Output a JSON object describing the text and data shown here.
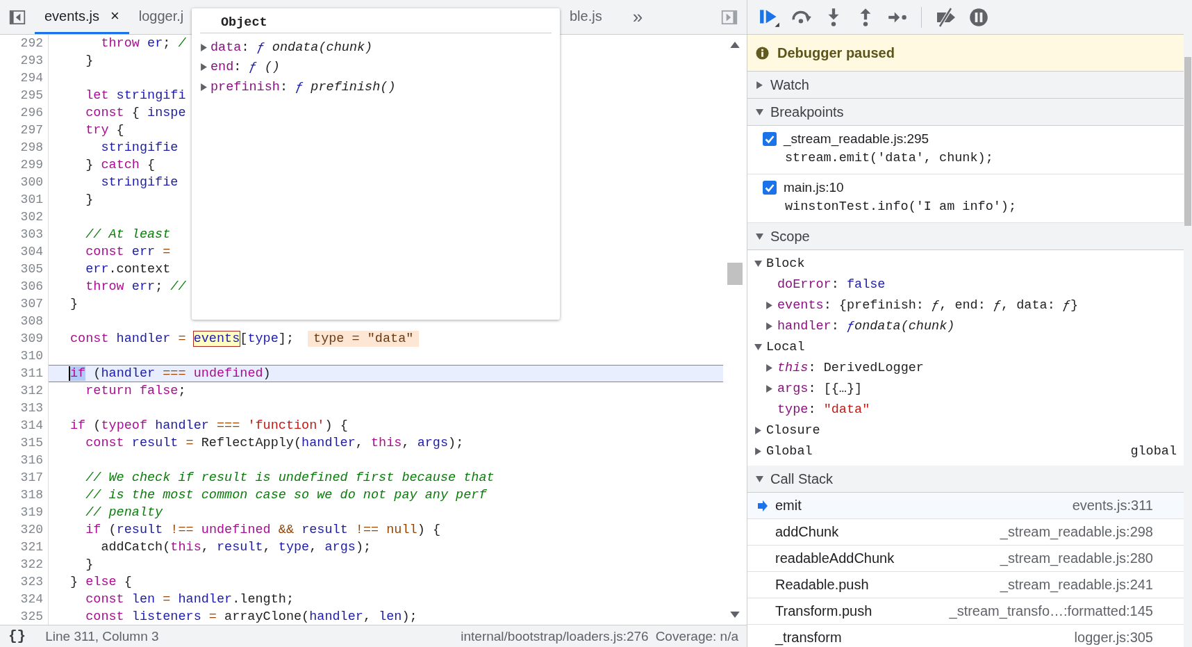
{
  "editor_tabs": {
    "items": [
      {
        "label": "events.js",
        "selected": true,
        "close": "×"
      },
      {
        "label": "logger.j",
        "selected": false
      },
      {
        "label": "ble.js",
        "selected": false
      }
    ],
    "overflow": "»"
  },
  "code": {
    "lines": [
      {
        "number": "292",
        "current": false,
        "tokens": [
          {
            "t": "    throw",
            "kind": "keyword"
          },
          {
            "t": " er",
            "kind": "variable"
          },
          {
            "t": "; ",
            "kind": "plain"
          },
          {
            "t": "/",
            "kind": "comment"
          }
        ]
      },
      {
        "number": "293",
        "current": false,
        "tokens": [
          {
            "t": "  }",
            "kind": "plain"
          }
        ]
      },
      {
        "number": "294",
        "current": false
      },
      {
        "number": "295",
        "current": false,
        "tokens": [
          {
            "t": "  let",
            "kind": "keyword"
          },
          {
            "t": " stringifi",
            "kind": "variable"
          }
        ]
      },
      {
        "number": "296",
        "current": false,
        "tokens": [
          {
            "t": "  const",
            "kind": "keyword"
          },
          {
            "t": " { ",
            "kind": "plain"
          },
          {
            "t": "inspe",
            "kind": "variable"
          }
        ]
      },
      {
        "number": "297",
        "current": false,
        "tokens": [
          {
            "t": "  try",
            "kind": "keyword"
          },
          {
            "t": " {",
            "kind": "plain"
          }
        ]
      },
      {
        "number": "298",
        "current": false,
        "tokens": [
          {
            "t": "    stringifie",
            "kind": "variable"
          }
        ]
      },
      {
        "number": "299",
        "current": false,
        "tokens": [
          {
            "t": "  } ",
            "kind": "plain"
          },
          {
            "t": "catch",
            "kind": "keyword"
          },
          {
            "t": " {",
            "kind": "plain"
          }
        ]
      },
      {
        "number": "300",
        "current": false,
        "tokens": [
          {
            "t": "    stringifie",
            "kind": "variable"
          }
        ]
      },
      {
        "number": "301",
        "current": false,
        "tokens": [
          {
            "t": "  }",
            "kind": "plain"
          }
        ]
      },
      {
        "number": "302",
        "current": false
      },
      {
        "number": "303",
        "current": false,
        "tokens": [
          {
            "t": "  // At least",
            "kind": "comment"
          }
        ]
      },
      {
        "number": "304",
        "current": false,
        "tokens": [
          {
            "t": "  const",
            "kind": "keyword"
          },
          {
            "t": " err",
            "kind": "variable"
          },
          {
            "t": " =",
            "kind": "operator"
          }
        ]
      },
      {
        "number": "305",
        "current": false,
        "tokens": [
          {
            "t": "  err",
            "kind": "variable"
          },
          {
            "t": ".context",
            "kind": "plain"
          }
        ]
      },
      {
        "number": "306",
        "current": false,
        "tokens": [
          {
            "t": "  throw",
            "kind": "keyword"
          },
          {
            "t": " err",
            "kind": "variable"
          },
          {
            "t": "; ",
            "kind": "plain"
          },
          {
            "t": "//",
            "kind": "comment"
          }
        ]
      },
      {
        "number": "307",
        "current": false,
        "tokens": [
          {
            "t": "}",
            "kind": "plain"
          }
        ]
      },
      {
        "number": "308",
        "current": false
      },
      {
        "number": "309",
        "current": false,
        "tokens": [
          {
            "t": "const",
            "kind": "keyword"
          },
          {
            "t": " handler",
            "kind": "variable"
          },
          {
            "t": " = ",
            "kind": "operator"
          },
          {
            "t": "events",
            "kind": "hovered"
          },
          {
            "t": "[",
            "kind": "plain"
          },
          {
            "t": "type",
            "kind": "variable"
          },
          {
            "t": "];",
            "kind": "plain"
          }
        ],
        "inline_value": "type = \"data\""
      },
      {
        "number": "310",
        "current": false
      },
      {
        "number": "311",
        "current": true,
        "tokens": [
          {
            "t": "if",
            "kind": "cursor"
          },
          {
            "t": " (",
            "kind": "plain"
          },
          {
            "t": "handler",
            "kind": "variable"
          },
          {
            "t": " === ",
            "kind": "operator"
          },
          {
            "t": "undefined",
            "kind": "keyword"
          },
          {
            "t": ")",
            "kind": "plain"
          }
        ]
      },
      {
        "number": "312",
        "current": false,
        "tokens": [
          {
            "t": "  return false",
            "kind": "keyword"
          },
          {
            "t": ";",
            "kind": "plain"
          }
        ]
      },
      {
        "number": "313",
        "current": false
      },
      {
        "number": "314",
        "current": false,
        "tokens": [
          {
            "t": "if",
            "kind": "keyword"
          },
          {
            "t": " (",
            "kind": "plain"
          },
          {
            "t": "typeof",
            "kind": "keyword"
          },
          {
            "t": " handler",
            "kind": "variable"
          },
          {
            "t": " === ",
            "kind": "operator"
          },
          {
            "t": "'function'",
            "kind": "string"
          },
          {
            "t": ") {",
            "kind": "plain"
          }
        ]
      },
      {
        "number": "315",
        "current": false,
        "tokens": [
          {
            "t": "  const",
            "kind": "keyword"
          },
          {
            "t": " result",
            "kind": "variable"
          },
          {
            "t": " = ",
            "kind": "operator"
          },
          {
            "t": "ReflectApply(",
            "kind": "plain"
          },
          {
            "t": "handler",
            "kind": "variable"
          },
          {
            "t": ", ",
            "kind": "plain"
          },
          {
            "t": "this",
            "kind": "keyword"
          },
          {
            "t": ", ",
            "kind": "plain"
          },
          {
            "t": "args",
            "kind": "variable"
          },
          {
            "t": ");",
            "kind": "plain"
          }
        ]
      },
      {
        "number": "316",
        "current": false
      },
      {
        "number": "317",
        "current": false,
        "tokens": [
          {
            "t": "  // We check if result is undefined first because that",
            "kind": "comment"
          }
        ]
      },
      {
        "number": "318",
        "current": false,
        "tokens": [
          {
            "t": "  // is the most common case so we do not pay any perf",
            "kind": "comment"
          }
        ]
      },
      {
        "number": "319",
        "current": false,
        "tokens": [
          {
            "t": "  // penalty",
            "kind": "comment"
          }
        ]
      },
      {
        "number": "320",
        "current": false,
        "tokens": [
          {
            "t": "  if",
            "kind": "keyword"
          },
          {
            "t": " (",
            "kind": "plain"
          },
          {
            "t": "result",
            "kind": "variable"
          },
          {
            "t": " !== ",
            "kind": "operator"
          },
          {
            "t": "undefined",
            "kind": "keyword"
          },
          {
            "t": " && ",
            "kind": "operator"
          },
          {
            "t": "result",
            "kind": "variable"
          },
          {
            "t": " !== ",
            "kind": "operator"
          },
          {
            "t": "null",
            "kind": "operator"
          },
          {
            "t": ") {",
            "kind": "plain"
          }
        ]
      },
      {
        "number": "321",
        "current": false,
        "tokens": [
          {
            "t": "    addCatch(",
            "kind": "plain"
          },
          {
            "t": "this",
            "kind": "keyword"
          },
          {
            "t": ", ",
            "kind": "plain"
          },
          {
            "t": "result",
            "kind": "variable"
          },
          {
            "t": ", ",
            "kind": "plain"
          },
          {
            "t": "type",
            "kind": "variable"
          },
          {
            "t": ", ",
            "kind": "plain"
          },
          {
            "t": "args",
            "kind": "variable"
          },
          {
            "t": ");",
            "kind": "plain"
          }
        ]
      },
      {
        "number": "322",
        "current": false,
        "tokens": [
          {
            "t": "  }",
            "kind": "plain"
          }
        ]
      },
      {
        "number": "323",
        "current": false,
        "tokens": [
          {
            "t": "} ",
            "kind": "plain"
          },
          {
            "t": "else",
            "kind": "keyword"
          },
          {
            "t": " {",
            "kind": "plain"
          }
        ]
      },
      {
        "number": "324",
        "current": false,
        "tokens": [
          {
            "t": "  const",
            "kind": "keyword"
          },
          {
            "t": " len",
            "kind": "variable"
          },
          {
            "t": " = ",
            "kind": "operator"
          },
          {
            "t": "handler",
            "kind": "variable"
          },
          {
            "t": ".length;",
            "kind": "plain"
          }
        ]
      },
      {
        "number": "325",
        "current": false,
        "tokens": [
          {
            "t": "  const",
            "kind": "keyword"
          },
          {
            "t": " listeners",
            "kind": "variable"
          },
          {
            "t": " = ",
            "kind": "operator"
          },
          {
            "t": "arrayClone(",
            "kind": "plain"
          },
          {
            "t": "handler",
            "kind": "variable"
          },
          {
            "t": ", ",
            "kind": "plain"
          },
          {
            "t": "len",
            "kind": "variable"
          },
          {
            "t": ");",
            "kind": "plain"
          }
        ]
      }
    ]
  },
  "object_popup": {
    "title": "Object",
    "properties": [
      {
        "name": "data",
        "delimiter": ":",
        "glyph": "ƒ",
        "signature": "ondata(chunk)",
        "expanded": false
      },
      {
        "name": "end",
        "delimiter": ":",
        "glyph": "ƒ",
        "signature": "()",
        "expanded": false
      },
      {
        "name": "prefinish",
        "delimiter": ":",
        "glyph": "ƒ",
        "signature": "prefinish()",
        "expanded": false
      }
    ]
  },
  "status_bar": {
    "format_button": "{}",
    "position": "Line 311, Column 3",
    "source": "internal/bootstrap/loaders.js:276",
    "coverage": "Coverage: n/a"
  },
  "debugger": {
    "banner": "Debugger paused",
    "watch": {
      "title": "Watch",
      "expanded": false
    },
    "breakpoints": {
      "title": "Breakpoints",
      "expanded": true,
      "items": [
        {
          "location": "_stream_readable.js:295",
          "code": "stream.emit('data', chunk);",
          "checked": true
        },
        {
          "location": "main.js:10",
          "code": "winstonTest.info('I am info');",
          "checked": true
        }
      ]
    },
    "scope": {
      "title": "Scope",
      "expanded": true,
      "groups": [
        {
          "label": "Block",
          "expanded": true,
          "children": [
            {
              "name": "doError",
              "delimiter": ":",
              "kind": "boolean",
              "value": "false"
            },
            {
              "name": "events",
              "delimiter": ":",
              "kind": "object",
              "value": "{prefinish: *ƒ*, end: *ƒ*, data: *ƒ*}",
              "expanded": false
            },
            {
              "name": "handler",
              "delimiter": ":",
              "kind": "function",
              "glyph": "ƒ",
              "value": "ondata(chunk)",
              "expanded": false
            }
          ]
        },
        {
          "label": "Local",
          "expanded": true,
          "children": [
            {
              "name": "this",
              "delimiter": ":",
              "kind": "receiver",
              "value": "DerivedLogger",
              "expanded": false
            },
            {
              "name": "args",
              "delimiter": ":",
              "kind": "object",
              "value": "[{…}]",
              "expanded": false
            },
            {
              "name": "type",
              "delimiter": ":",
              "kind": "string",
              "value": "\"data\""
            }
          ]
        },
        {
          "label": "Closure",
          "expanded": false
        },
        {
          "label": "Global",
          "expanded": false,
          "value": "global"
        }
      ]
    },
    "call_stack": {
      "title": "Call Stack",
      "expanded": true,
      "frames": [
        {
          "name": "emit",
          "location": "events.js:311",
          "selected": true
        },
        {
          "name": "addChunk",
          "location": "_stream_readable.js:298",
          "selected": false
        },
        {
          "name": "readableAddChunk",
          "location": "_stream_readable.js:280",
          "selected": false
        },
        {
          "name": "Readable.push",
          "location": "_stream_readable.js:241",
          "selected": false
        },
        {
          "name": "Transform.push",
          "location": "_stream_transfo…:formatted:145",
          "selected": false
        },
        {
          "name": "_transform",
          "location": "logger.js:305",
          "selected": false
        }
      ]
    }
  }
}
